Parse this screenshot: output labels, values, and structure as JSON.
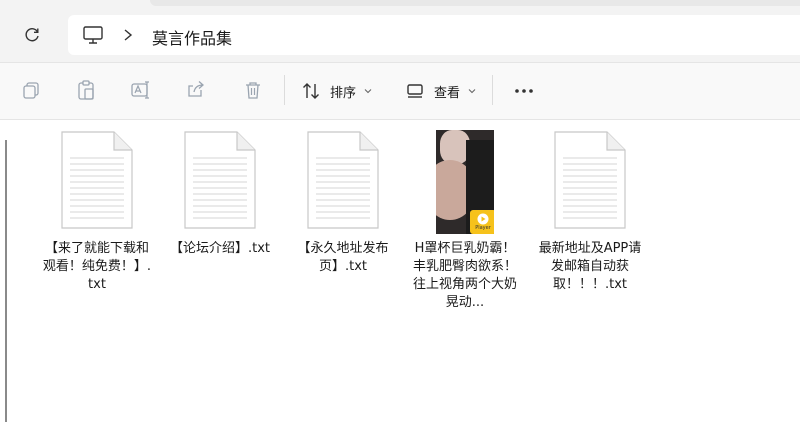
{
  "address": {
    "breadcrumb": "莫言作品集"
  },
  "toolbar": {
    "sort_label": "排序",
    "view_label": "查看"
  },
  "files": [
    {
      "name": "【来了就能下载和观看！纯免费！】.txt",
      "type": "text"
    },
    {
      "name": "【论坛介绍】.txt",
      "type": "text"
    },
    {
      "name": "【永久地址发布页】.txt",
      "type": "text"
    },
    {
      "name": "H罩杯巨乳奶霸！丰乳肥臀肉欲系！往上视角两个大奶晃动...",
      "type": "video",
      "badge": "Player"
    },
    {
      "name": "最新地址及APP请发邮箱自动获取！！！.txt",
      "type": "text"
    }
  ],
  "colors": {
    "accent": "#0067c0",
    "badge": "#f6c21b"
  }
}
